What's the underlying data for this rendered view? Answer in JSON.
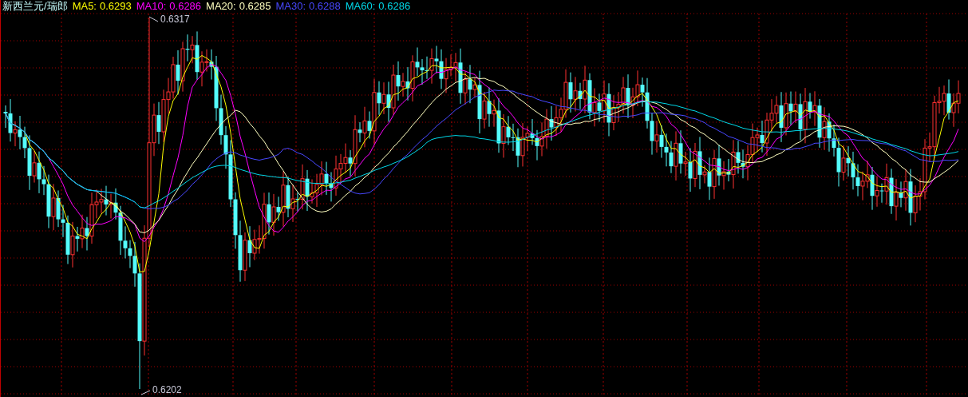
{
  "title": "新西兰元/瑞郎",
  "ma_legend": [
    {
      "label": "MA5:",
      "value": "0.6293",
      "color": "#ffff00"
    },
    {
      "label": "MA10:",
      "value": "0.6286",
      "color": "#ff00ff"
    },
    {
      "label": "MA20:",
      "value": "0.6285",
      "color": "#ffffc0"
    },
    {
      "label": "MA30:",
      "value": "0.6288",
      "color": "#4848ff"
    },
    {
      "label": "MA60:",
      "value": "0.6286",
      "color": "#00d8e8"
    }
  ],
  "high_marker": "0.6317",
  "low_marker": "0.6202"
}
